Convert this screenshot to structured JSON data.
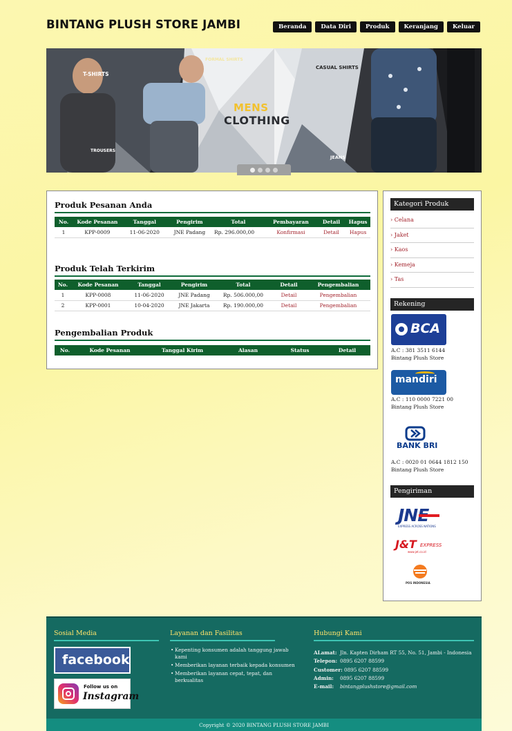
{
  "site": {
    "title": "BINTANG PLUSH STORE JAMBI"
  },
  "nav": [
    "Beranda",
    "Data Diri",
    "Produk",
    "Keranjang",
    "Keluar"
  ],
  "banner": {
    "labels": {
      "tshirts": "T-SHIRTS",
      "formal": "FORMAL SHIRTS",
      "casual": "CASUAL SHIRTS",
      "mens": "MENS",
      "clothing": "CLOTHING",
      "trousers": "TROUSERS",
      "jeans": "JEANS"
    },
    "accent": "#f2c12e"
  },
  "pesanan": {
    "title": "Produk Pesanan Anda",
    "headers": [
      "No.",
      "Kode Pesanan",
      "Tanggal",
      "Pengirim",
      "Total",
      "Pembayaran",
      "Detail",
      "Hapus"
    ],
    "rows": [
      {
        "no": "1",
        "kode": "KPP-0009",
        "tanggal": "11-06-2020",
        "pengirim": "JNE Padang",
        "total": "Rp. 296.000,00",
        "pembayaran": "Konfirmasi",
        "detail": "Detail",
        "hapus": "Hapus"
      }
    ]
  },
  "terkirim": {
    "title": "Produk Telah Terkirim",
    "headers": [
      "No.",
      "Kode Pesanan",
      "Tanggal",
      "Pengirim",
      "Total",
      "Detail",
      "Pengembalian"
    ],
    "rows": [
      {
        "no": "1",
        "kode": "KPP-0008",
        "tanggal": "11-06-2020",
        "pengirim": "JNE Padang",
        "total": "Rp. 506.000,00",
        "detail": "Detail",
        "pengembalian": "Pengembalian"
      },
      {
        "no": "2",
        "kode": "KPP-0001",
        "tanggal": "10-04-2020",
        "pengirim": "JNE Jakarta",
        "total": "Rp. 190.000,00",
        "detail": "Detail",
        "pengembalian": "Pengembalian"
      }
    ]
  },
  "pengembalian": {
    "title": "Pengembalian Produk",
    "headers": [
      "No.",
      "Kode Pesanan",
      "Tanggal Kirim",
      "Alasan",
      "Status",
      "Detail"
    ]
  },
  "sidebar": {
    "kategori_title": "Kategori Produk",
    "kategori": [
      "Celana",
      "Jaket",
      "Kaos",
      "Kemeja",
      "Tas"
    ],
    "rekening_title": "Rekening",
    "banks": [
      {
        "logo": "BCA",
        "account": "A.C : 381 3511 6144",
        "holder": "Bintang Plush Store"
      },
      {
        "logo": "mandiri",
        "account": "A.C : 110 0000 7221 00",
        "holder": "Bintang Plush Store"
      },
      {
        "logo": "BANK BRI",
        "account": "A.C : 0020 01 0644 1812 150",
        "holder": "Bintang Plush Store"
      }
    ],
    "pengiriman_title": "Pengiriman",
    "couriers": {
      "jne": "JNE",
      "jne_tag": "EXPRESS ACROSS NATIONS",
      "jnt": "J&T",
      "jnt_tag": "EXPRESS",
      "jnt_url": "www.jet.co.id",
      "pos": "POS INDONESIA"
    }
  },
  "footer": {
    "social_title": "Sosial Media",
    "facebook": "facebook",
    "instagram_follow": "Follow us on",
    "instagram": "Instagram",
    "layanan_title": "Layanan dan Fasilitas",
    "layanan": [
      "Kepenting konsumen adalah tanggung jawab kami",
      "Memberikan layanan terbaik kepada konsumen",
      "Memberikan layanan cepat, tepat, dan berkualitas"
    ],
    "kontak_title": "Hubungi Kami",
    "kontak": {
      "alamat_label": "ALamat:",
      "alamat": "Jln. Kapten Dirham RT 55, No. 51, Jambi - Indonesia",
      "telepon_label": "Telepon:",
      "telepon": "0895 6207 88599",
      "customer_label": "Customer:",
      "customer": "0895 6207 88599",
      "admin_label": "Admin:",
      "admin": "0895 6207 88599",
      "email_label": "E-mail:",
      "email": "bintangplushstore@gmail.com"
    },
    "copyright": "Copyright © 2020 BINTANG PLUSH STORE JAMBI"
  },
  "colors": {
    "table_header": "#0f5f2c",
    "link": "#a3232c",
    "footer": "#156a61",
    "sidebar_head": "#252525"
  }
}
